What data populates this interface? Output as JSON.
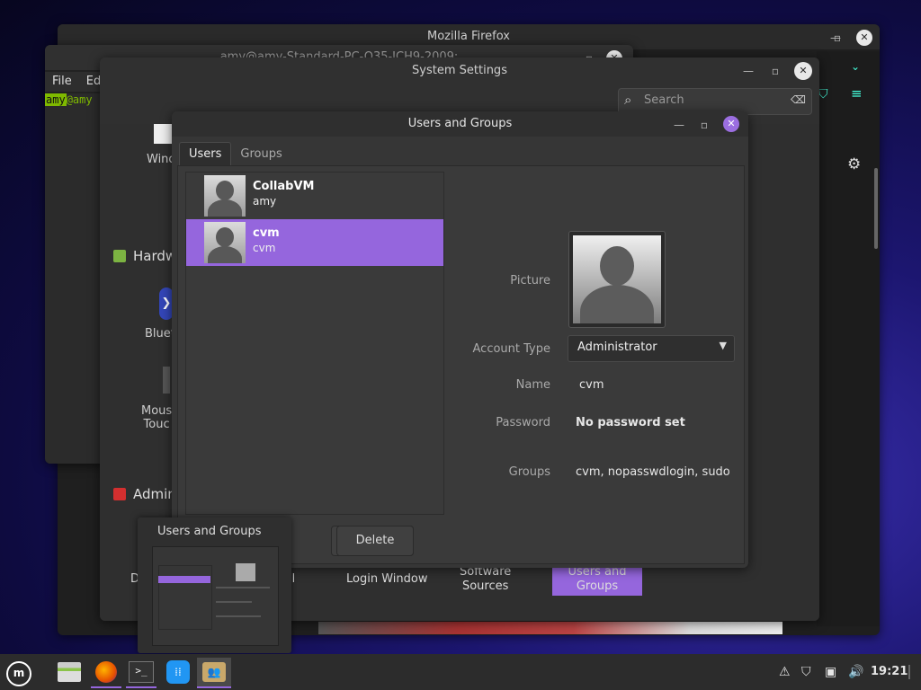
{
  "firefox": {
    "title": "Mozilla Firefox"
  },
  "terminal": {
    "title": "amy@amy-Standard-PC-Q35-ICH9-2009:",
    "menu": [
      "File",
      "Ed"
    ],
    "prompt_user": "amy",
    "prompt_rest": "@amy"
  },
  "settings": {
    "title": "System Settings",
    "search_placeholder": "Search",
    "items": {
      "windows": "Windo",
      "hardware_section": "Hardw",
      "bluetooth": "Bluet",
      "mouse": "Mous",
      "mouse2": "Touc",
      "admin_section": "Admin",
      "bottom_d": "D",
      "bottom_ll": "ll",
      "login_window": "Login Window",
      "software_sources_1": "Software",
      "software_sources_2": "Sources",
      "users_groups_1": "Users and",
      "users_groups_2": "Groups"
    }
  },
  "users_groups": {
    "title": "Users and Groups",
    "tabs": [
      "Users",
      "Groups"
    ],
    "users": [
      {
        "name": "CollabVM",
        "login": "amy"
      },
      {
        "name": "cvm",
        "login": "cvm"
      }
    ],
    "labels": {
      "picture": "Picture",
      "account_type": "Account Type",
      "name": "Name",
      "password": "Password",
      "groups": "Groups"
    },
    "values": {
      "account_type": "Administrator",
      "name": "cvm",
      "password": "No password set",
      "groups": "cvm, nopasswdlogin, sudo"
    },
    "delete_button": "Delete"
  },
  "thumbnail": {
    "title": "Users and Groups"
  },
  "panel": {
    "clock": "19:21"
  },
  "colors": {
    "accent": "#9566dd",
    "desktop": "#1c1670"
  }
}
